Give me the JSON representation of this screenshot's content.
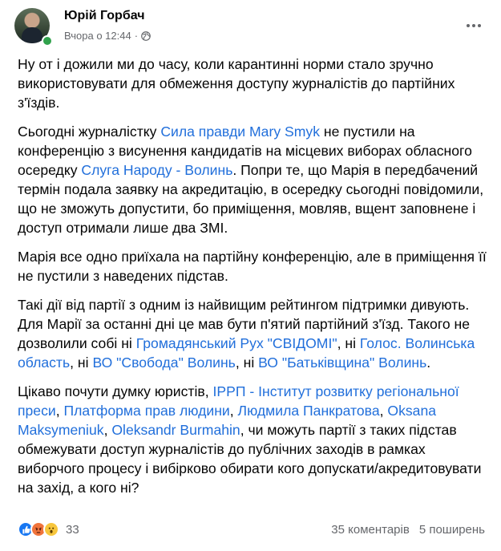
{
  "post": {
    "author": "Юрій Горбач",
    "timestamp": "Вчора о 12:44",
    "separator": "·",
    "privacy_icon": "globe-icon",
    "more_icon": "more-horizontal-icon",
    "paragraphs": [
      [
        {
          "text": "Ну от і дожили ми до часу, коли карантинні норми стало зручно використовувати для обмеження доступу журналістів до партійних з'їздів."
        }
      ],
      [
        {
          "text": "Сьогодні журналістку "
        },
        {
          "text": "Сила правди",
          "link": true
        },
        {
          "text": " "
        },
        {
          "text": "Mary Smyk",
          "link": true
        },
        {
          "text": " не пустили на конференцію з висунення кандидатів на місцевих виборах обласного осередку "
        },
        {
          "text": "Слуга Народу - Волинь",
          "link": true
        },
        {
          "text": ". Попри те, що Марія в передбачений термін подала заявку на акредитацію, в осередку сьогодні повідомили, що не зможуть допустити, бо приміщення, мовляв, вщент заповнене і доступ отримали лише два ЗМІ."
        }
      ],
      [
        {
          "text": "Марія все одно приїхала на партійну конференцію, але в приміщення її не пустили з наведених підстав."
        }
      ],
      [
        {
          "text": "Такі дії від партії з одним із найвищим рейтингом підтримки дивують. Для Марії за останні дні це мав бути п'ятий партійний з'їзд. Такого не дозволили собі ні "
        },
        {
          "text": "Громадянський Рух \"СВІДОМІ\"",
          "link": true
        },
        {
          "text": ", ні "
        },
        {
          "text": "Голос. Волинська область",
          "link": true
        },
        {
          "text": ", ні "
        },
        {
          "text": "ВО \"Свобода\" Волинь",
          "link": true
        },
        {
          "text": ", ні "
        },
        {
          "text": "ВО \"Батьківщина\" Волинь",
          "link": true
        },
        {
          "text": "."
        }
      ],
      [
        {
          "text": "Цікаво почути думку юристів, "
        },
        {
          "text": "ІРРП - Інститут розвитку регіональної преси",
          "link": true
        },
        {
          "text": ", "
        },
        {
          "text": "Платформа прав людини",
          "link": true
        },
        {
          "text": ", "
        },
        {
          "text": "Людмила Панкратова",
          "link": true
        },
        {
          "text": ", "
        },
        {
          "text": "Oksana Maksymeniuk",
          "link": true
        },
        {
          "text": ", "
        },
        {
          "text": "Oleksandr Burmahin",
          "link": true
        },
        {
          "text": ", чи можуть партії з таких підстав обмежувати доступ журналістів до публічних заходів в рамках виборчого процесу і вибірково обирати кого допускати/акредитовувати на захід, а кого ні?"
        }
      ]
    ]
  },
  "footer": {
    "reactions": [
      "like-icon",
      "angry-icon",
      "wow-icon"
    ],
    "reaction_count": "33",
    "comments": "35 коментарів",
    "shares": "5 поширень"
  },
  "colors": {
    "link": "#216fdb",
    "meta": "#65676b",
    "online": "#31a24c",
    "like": "#1877f2"
  }
}
